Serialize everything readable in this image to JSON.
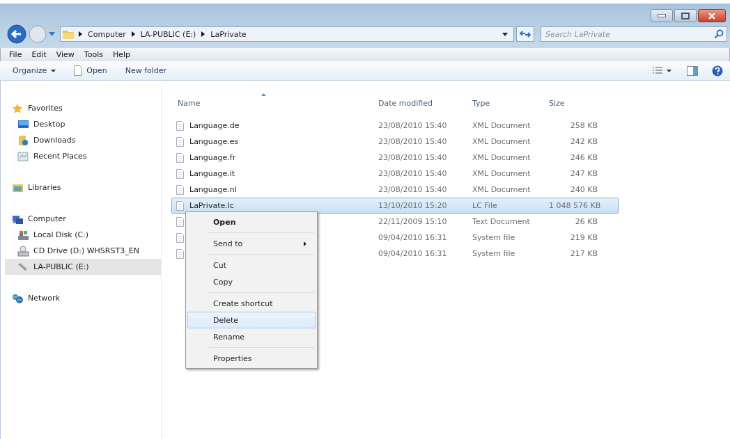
{
  "address_bar": {
    "path": [
      "Computer",
      "LA-PUBLIC (E:)",
      "LaPrivate"
    ]
  },
  "search": {
    "placeholder": "Search LaPrivate"
  },
  "menu_bar": [
    "File",
    "Edit",
    "View",
    "Tools",
    "Help"
  ],
  "toolbar": {
    "organize": "Organize",
    "open": "Open",
    "new_folder": "New folder"
  },
  "sidebar": [
    {
      "label": "Favorites",
      "selected": false,
      "children": [
        {
          "label": "Desktop",
          "selected": false
        },
        {
          "label": "Downloads",
          "selected": false
        },
        {
          "label": "Recent Places",
          "selected": false
        }
      ]
    },
    {
      "label": "Libraries",
      "selected": false
    },
    {
      "label": "Computer",
      "selected": false,
      "children": [
        {
          "label": "Local Disk (C:)",
          "selected": false
        },
        {
          "label": "CD Drive (D:) WHSRST3_EN",
          "selected": false
        },
        {
          "label": "LA-PUBLIC (E:)",
          "selected": true
        }
      ]
    },
    {
      "label": "Network",
      "selected": false
    }
  ],
  "table": {
    "columns": [
      "Name",
      "Date modified",
      "Type",
      "Size"
    ],
    "rows": [
      {
        "name": "Language.de",
        "date": "23/08/2010 15:40",
        "type": "XML Document",
        "size": "258 KB",
        "selected": false
      },
      {
        "name": "Language.es",
        "date": "23/08/2010 15:40",
        "type": "XML Document",
        "size": "242 KB",
        "selected": false
      },
      {
        "name": "Language.fr",
        "date": "23/08/2010 15:40",
        "type": "XML Document",
        "size": "246 KB",
        "selected": false
      },
      {
        "name": "Language.it",
        "date": "23/08/2010 15:40",
        "type": "XML Document",
        "size": "247 KB",
        "selected": false
      },
      {
        "name": "Language.nl",
        "date": "23/08/2010 15:40",
        "type": "XML Document",
        "size": "240 KB",
        "selected": false
      },
      {
        "name": "LaPrivate.lc",
        "date": "13/10/2010 15:20",
        "type": "LC File",
        "size": "1 048 576 KB",
        "selected": true
      },
      {
        "date": "22/11/2009 15:10",
        "type": "Text Document",
        "size": "26 KB",
        "selected": false
      },
      {
        "date": "09/04/2010 16:31",
        "type": "System file",
        "size": "219 KB",
        "selected": false
      },
      {
        "date": "09/04/2010 16:31",
        "type": "System file",
        "size": "217 KB",
        "selected": false
      }
    ]
  },
  "context_menu": [
    {
      "kind": "item",
      "label": "Open",
      "bold": true,
      "submenu": false,
      "selected": false
    },
    {
      "kind": "separator"
    },
    {
      "kind": "item",
      "label": "Send to",
      "bold": false,
      "submenu": true,
      "selected": false
    },
    {
      "kind": "separator"
    },
    {
      "kind": "item",
      "label": "Cut",
      "bold": false,
      "submenu": false,
      "selected": false
    },
    {
      "kind": "item",
      "label": "Copy",
      "bold": false,
      "submenu": false,
      "selected": false
    },
    {
      "kind": "separator"
    },
    {
      "kind": "item",
      "label": "Create shortcut",
      "bold": false,
      "submenu": false,
      "selected": false
    },
    {
      "kind": "item",
      "label": "Delete",
      "bold": false,
      "submenu": false,
      "selected": true
    },
    {
      "kind": "item",
      "label": "Rename",
      "bold": false,
      "submenu": false,
      "selected": false
    },
    {
      "kind": "separator"
    },
    {
      "kind": "item",
      "label": "Properties",
      "bold": false,
      "submenu": false,
      "selected": false
    }
  ]
}
